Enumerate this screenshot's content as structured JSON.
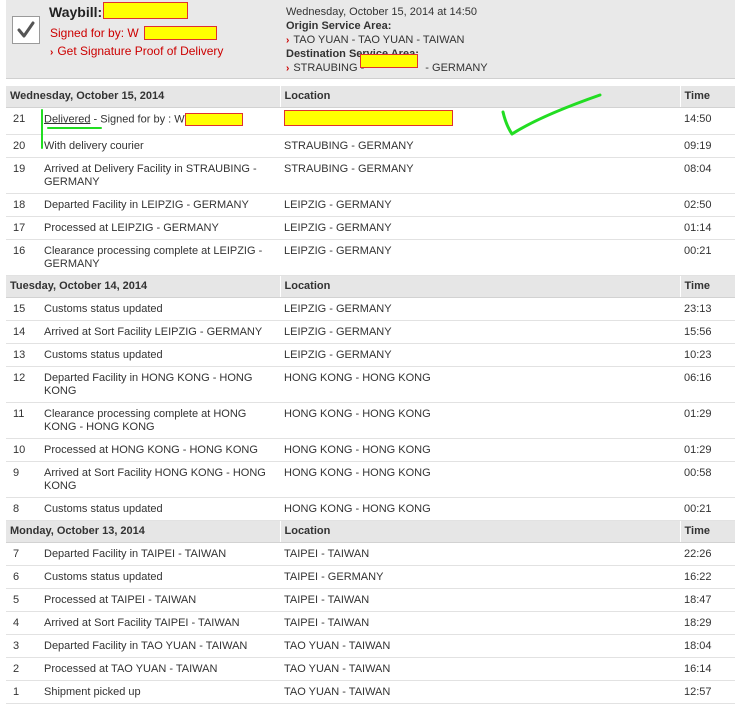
{
  "header": {
    "waybill_label": "Waybill:",
    "signed_for": "Signed for by: W",
    "proof_link": "Get Signature Proof of Delivery",
    "datetime": "Wednesday, October 15, 2014 at 14:50",
    "origin_label": "Origin Service Area:",
    "origin_value": "TAO YUAN - TAO YUAN - TAIWAN",
    "destination_label": "Destination Service Area:",
    "destination_prefix": "STRAUBING - ",
    "destination_suffix": "- GERMANY",
    "arrow_glyph": "›"
  },
  "columns": {
    "location": "Location",
    "time": "Time"
  },
  "days": [
    {
      "date": "Wednesday, October 15, 2014",
      "events": [
        {
          "num": "21",
          "desc_link": "Delivered",
          "desc": " - Signed for by : W",
          "location": "",
          "time": "14:50",
          "highlight": true
        },
        {
          "num": "20",
          "desc": "With delivery courier",
          "location": "STRAUBING - GERMANY",
          "time": "09:19"
        },
        {
          "num": "19",
          "desc": "Arrived at Delivery Facility in STRAUBING - GERMANY",
          "location": "STRAUBING - GERMANY",
          "time": "08:04"
        },
        {
          "num": "18",
          "desc": "Departed Facility in LEIPZIG - GERMANY",
          "location": "LEIPZIG - GERMANY",
          "time": "02:50"
        },
        {
          "num": "17",
          "desc": "Processed at LEIPZIG - GERMANY",
          "location": "LEIPZIG - GERMANY",
          "time": "01:14"
        },
        {
          "num": "16",
          "desc": "Clearance processing complete at LEIPZIG - GERMANY",
          "location": "LEIPZIG - GERMANY",
          "time": "00:21"
        }
      ]
    },
    {
      "date": "Tuesday, October 14, 2014",
      "events": [
        {
          "num": "15",
          "desc": "Customs status updated",
          "location": "LEIPZIG - GERMANY",
          "time": "23:13"
        },
        {
          "num": "14",
          "desc": "Arrived at Sort Facility LEIPZIG - GERMANY",
          "location": "LEIPZIG - GERMANY",
          "time": "15:56"
        },
        {
          "num": "13",
          "desc": "Customs status updated",
          "location": "LEIPZIG - GERMANY",
          "time": "10:23"
        },
        {
          "num": "12",
          "desc": "Departed Facility in HONG KONG - HONG KONG",
          "location": "HONG KONG - HONG KONG",
          "time": "06:16"
        },
        {
          "num": "11",
          "desc": "Clearance processing complete at HONG KONG - HONG KONG",
          "location": "HONG KONG - HONG KONG",
          "time": "01:29"
        },
        {
          "num": "10",
          "desc": "Processed at HONG KONG - HONG KONG",
          "location": "HONG KONG - HONG KONG",
          "time": "01:29"
        },
        {
          "num": "9",
          "desc": "Arrived at Sort Facility HONG KONG - HONG KONG",
          "location": "HONG KONG - HONG KONG",
          "time": "00:58"
        },
        {
          "num": "8",
          "desc": "Customs status updated",
          "location": "HONG KONG - HONG KONG",
          "time": "00:21"
        }
      ]
    },
    {
      "date": "Monday, October 13, 2014",
      "events": [
        {
          "num": "7",
          "desc": "Departed Facility in TAIPEI - TAIWAN",
          "location": "TAIPEI - TAIWAN",
          "time": "22:26"
        },
        {
          "num": "6",
          "desc": "Customs status updated",
          "location": "TAIPEI - GERMANY",
          "time": "16:22"
        },
        {
          "num": "5",
          "desc": "Processed at TAIPEI - TAIWAN",
          "location": "TAIPEI - TAIWAN",
          "time": "18:47"
        },
        {
          "num": "4",
          "desc": "Arrived at Sort Facility TAIPEI - TAIWAN",
          "location": "TAIPEI - TAIWAN",
          "time": "18:29"
        },
        {
          "num": "3",
          "desc": "Departed Facility in TAO YUAN - TAIWAN",
          "location": "TAO YUAN - TAIWAN",
          "time": "18:04"
        },
        {
          "num": "2",
          "desc": "Processed at TAO YUAN - TAIWAN",
          "location": "TAO YUAN - TAIWAN",
          "time": "16:14"
        },
        {
          "num": "1",
          "desc": "Shipment picked up",
          "location": "TAO YUAN - TAIWAN",
          "time": "12:57"
        }
      ]
    }
  ],
  "colors": {
    "accent_red": "#cc0000",
    "redaction_fill": "#ffff00",
    "redaction_border": "#e03030",
    "annotation_green": "#22dd22",
    "header_bg": "#e9e9e9",
    "day_header_bg": "#e6e6e6"
  },
  "icons": {
    "status": "checkmark-icon",
    "link_arrow": "chevron-right-icon"
  }
}
